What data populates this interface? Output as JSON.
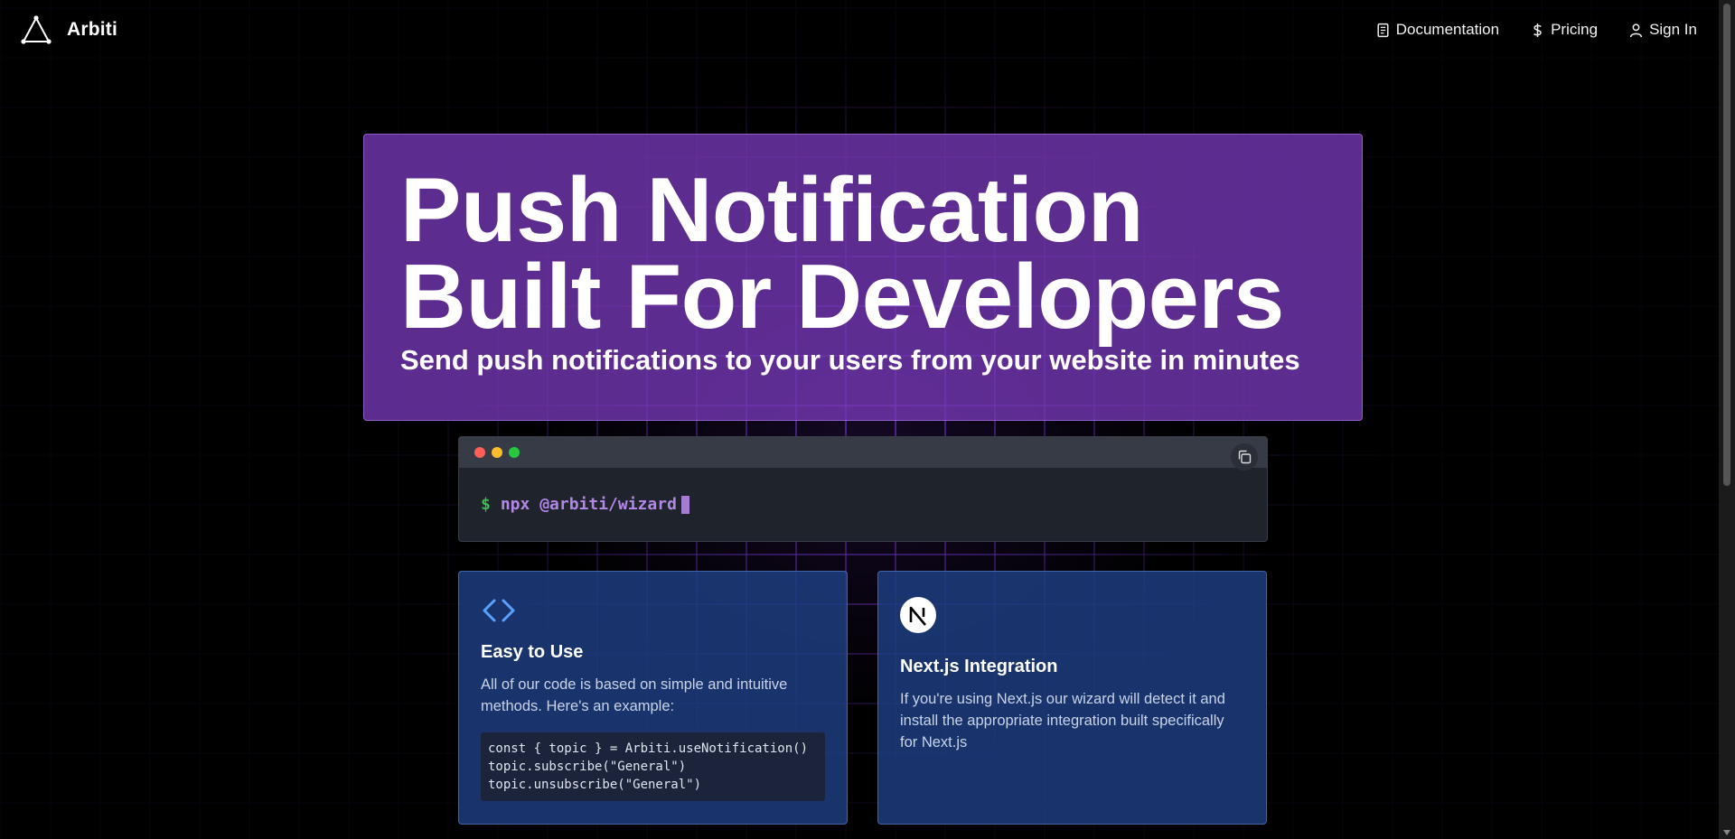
{
  "header": {
    "brand_name": "Arbiti",
    "nav": [
      {
        "label": "Documentation",
        "icon": "document-icon"
      },
      {
        "label": "Pricing",
        "icon": "dollar-icon"
      },
      {
        "label": "Sign In",
        "icon": "user-icon"
      }
    ]
  },
  "hero": {
    "title_line1": "Push Notification",
    "title_line2": "Built For Developers",
    "subtitle": "Send push notifications to your users from your website in minutes"
  },
  "terminal": {
    "prompt": "$",
    "command": "npx @arbiti/wizard",
    "dot_colors": [
      "#ff5f56",
      "#ffbd2e",
      "#27c93f"
    ]
  },
  "cards": {
    "easy": {
      "title": "Easy to Use",
      "text": "All of our code is based on simple and intuitive methods. Here's an example:",
      "code_lines": [
        "const { topic } = Arbiti.useNotification()",
        "topic.subscribe(\"General\")",
        "topic.unsubscribe(\"General\")"
      ]
    },
    "nextjs": {
      "title": "Next.js Integration",
      "text": "If you're using Next.js our wizard will detect it and install the appropriate integration built specifically for Next.js"
    }
  },
  "colors": {
    "hero_bg": "#7638b6",
    "card_bg": "#1e4084",
    "accent_purple": "#b287e6",
    "prompt_green": "#3fb950"
  }
}
